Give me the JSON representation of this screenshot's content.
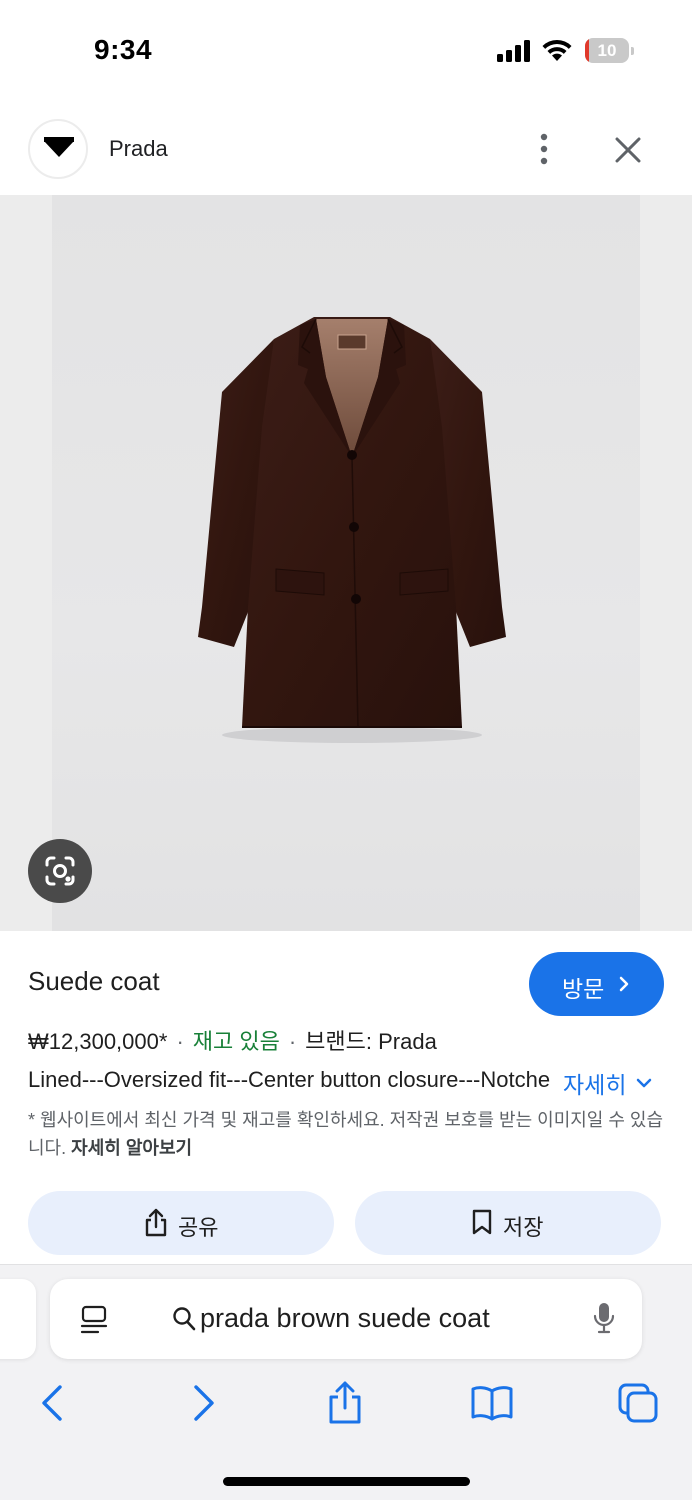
{
  "status_bar": {
    "time": "9:34",
    "battery_level": "10",
    "battery_percent": 10,
    "battery_color": "#e0392b"
  },
  "header": {
    "site_name": "Prada",
    "logo_icon": "prada-triangle-logo",
    "more_icon": "more-vert-icon",
    "close_icon": "close-icon"
  },
  "image": {
    "alt": "Suede coat",
    "lens_icon": "google-lens-icon",
    "background": "#e5e5e6"
  },
  "product": {
    "title": "Suede coat",
    "visit_label": "방문",
    "price": "₩12,300,000*",
    "separator": "·",
    "stock": "재고 있음",
    "brand": "브랜드: Prada",
    "description": "Lined---Oversized fit---Center button closure---Notched lapels---Flap pockets",
    "more_label": "자세히",
    "disclaimer": "* 웹사이트에서 최신 가격 및 재고를 확인하세요. 저작권 보호를 받는 이미지일 수 있습니다.",
    "learn_more": "자세히 알아보기",
    "share_label": "공유",
    "save_label": "저장",
    "accent_color": "#1a73e8",
    "stock_color": "#188038"
  },
  "safari": {
    "address": "prada brown suede coat",
    "toolbar_icons": [
      "back-icon",
      "forward-icon",
      "share-icon",
      "bookmarks-icon",
      "tabs-icon"
    ]
  }
}
